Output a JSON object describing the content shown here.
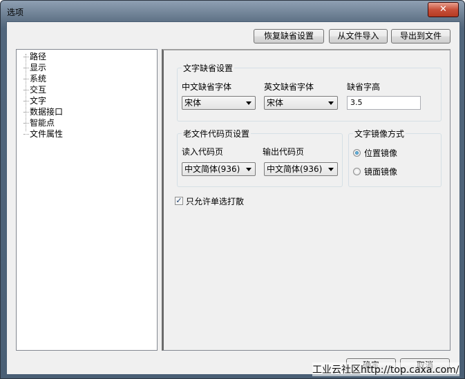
{
  "window": {
    "title": "选项",
    "close_label": "✕"
  },
  "toolbar": {
    "restore_defaults": "恢复缺省设置",
    "import_from_file": "从文件导入",
    "export_to_file": "导出到文件"
  },
  "tree": {
    "items": [
      "路径",
      "显示",
      "系统",
      "交互",
      "文字",
      "数据接口",
      "智能点",
      "文件属性"
    ]
  },
  "text_defaults": {
    "title": "文字缺省设置",
    "chinese_font_label": "中文缺省字体",
    "chinese_font_value": "宋体",
    "english_font_label": "英文缺省字体",
    "english_font_value": "宋体",
    "height_label": "缺省字高",
    "height_value": "3.5"
  },
  "codepage": {
    "title": "老文件代码页设置",
    "read_label": "读入代码页",
    "read_value": "中文简体(936)",
    "output_label": "输出代码页",
    "output_value": "中文简体(936)"
  },
  "mirror": {
    "title": "文字镜像方式",
    "options": [
      "位置镜像",
      "镜面镜像"
    ],
    "selected": "位置镜像"
  },
  "single_select": {
    "label": "只允许单选打散",
    "checked": true,
    "check_glyph": "✓"
  },
  "footer": {
    "ok": "确定",
    "cancel": "取消"
  },
  "watermark": "工业云社区http://top.caxa.com/"
}
